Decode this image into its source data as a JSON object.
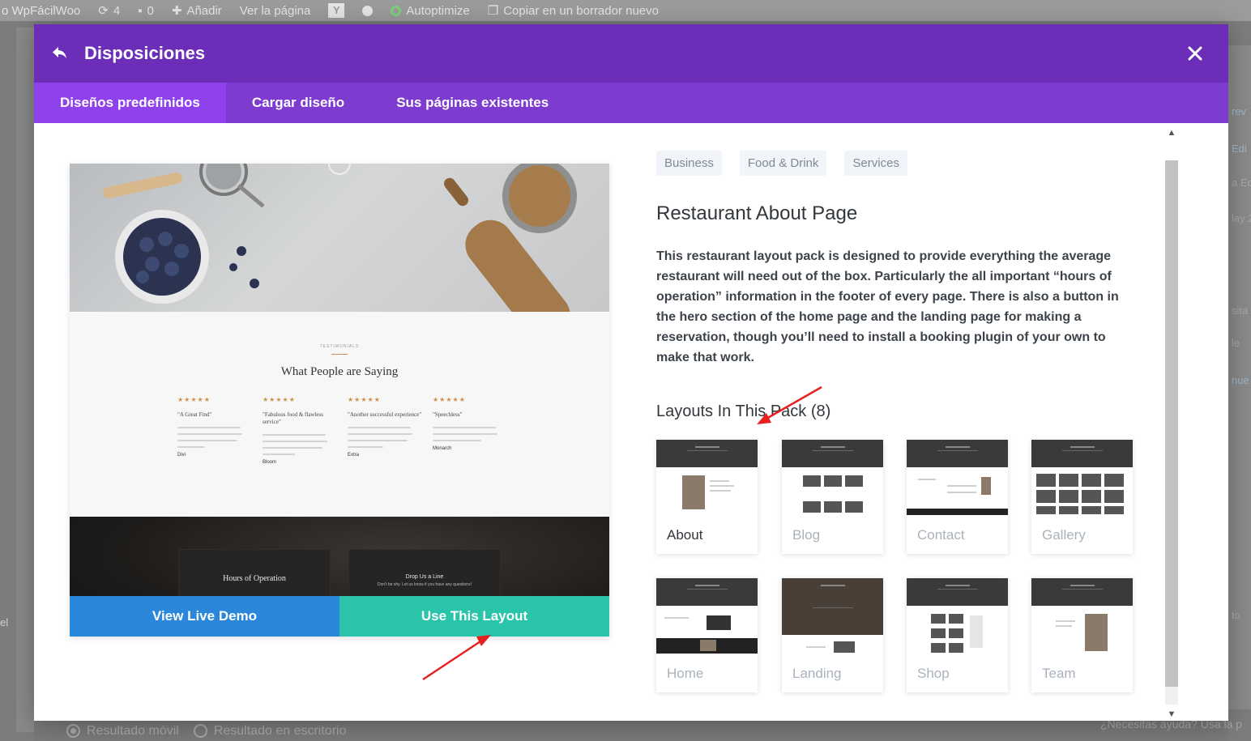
{
  "adminbar": {
    "site_name": "o WpFácilWoo",
    "updates_count": "4",
    "comments_count": "0",
    "add_label": "Añadir",
    "view_page_label": "Ver la página",
    "autoptimize_label": "Autoptimize",
    "copy_draft_label": "Copiar en un borrador nuevo"
  },
  "backdrop": {
    "left_label": "el",
    "right_fragments": [
      "rev",
      "Edi",
      "a Ed",
      "lay 2",
      "sita ",
      "le",
      "nue",
      "to"
    ],
    "radio_mobile": "Resultado móvil",
    "radio_desktop": "Resultado en escritorio",
    "help_text": "¿Necesitas ayuda? Usa la p"
  },
  "modal": {
    "title": "Disposiciones",
    "tabs": [
      {
        "label": "Diseños predefinidos",
        "active": true
      },
      {
        "label": "Cargar diseño",
        "active": false
      },
      {
        "label": "Sus páginas existentes",
        "active": false
      }
    ],
    "preview": {
      "testimonials_kicker": "TESTIMONIALS",
      "testimonials_title": "What People are Saying",
      "stars": "★★★★★",
      "testimonials": [
        {
          "quote": "\"A Great Find\"",
          "name": "Divi"
        },
        {
          "quote": "\"Fabulous food & flawless service\"",
          "name": "Bloom"
        },
        {
          "quote": "\"Another successful experience\"",
          "name": "Extra"
        },
        {
          "quote": "\"Speechless\"",
          "name": "Monarch"
        }
      ],
      "hours_title": "Hours of Operation",
      "drop_line_title": "Drop Us a Line",
      "drop_line_sub": "Don't be shy. Let us know if you have any questions!",
      "view_demo_label": "View Live Demo",
      "use_layout_label": "Use This Layout"
    },
    "tags": [
      "Business",
      "Food & Drink",
      "Services"
    ],
    "layout_title": "Restaurant About Page",
    "layout_description": "This restaurant layout pack is designed to provide everything the average restaurant will need out of the box. Particularly the all important “hours of operation” information in the footer of every page. There is also a button in the hero section of the home page and the landing page for making a reservation, though you’ll need to install a booking plugin of your own to make that work.",
    "pack_title": "Layouts In This Pack (8)",
    "pack_layouts": [
      "About",
      "Blog",
      "Contact",
      "Gallery",
      "Home",
      "Landing",
      "Shop",
      "Team"
    ],
    "current_layout": "About"
  },
  "colors": {
    "header": "#6c2eb9",
    "tabs": "#7e3bd0",
    "active_tab": "#8f42ec",
    "demo_button": "#2b87da",
    "use_button": "#29c4a9",
    "annotation": "#e8201f"
  },
  "icons": [
    "sync-icon",
    "comment-icon",
    "plus-icon",
    "yoast-icon",
    "status-dot-icon",
    "autoptimize-icon",
    "copy-icon",
    "back-arrow-icon",
    "close-icon",
    "chevron-up-icon",
    "chevron-down-icon"
  ]
}
